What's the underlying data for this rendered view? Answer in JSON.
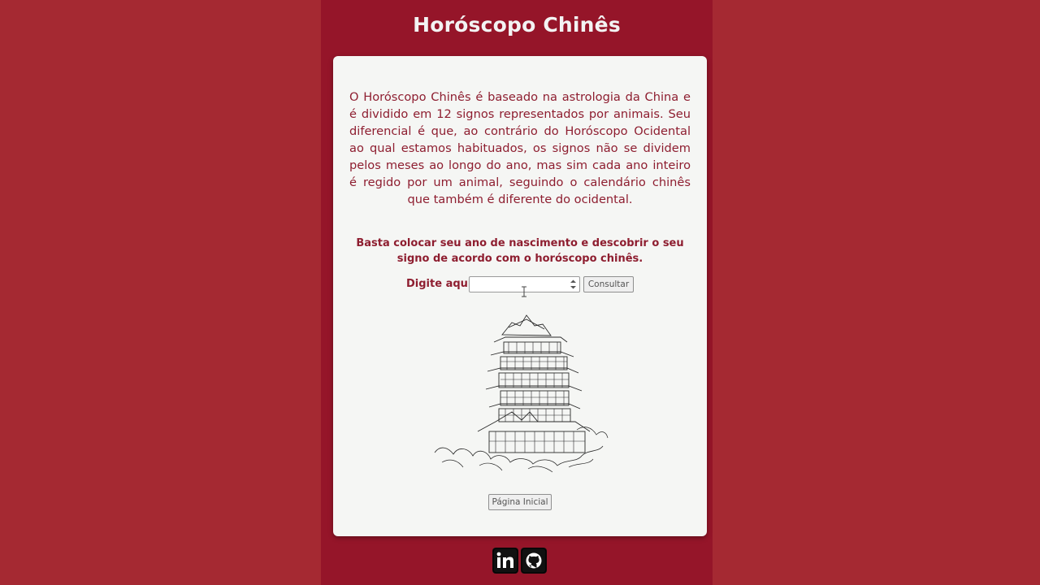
{
  "page": {
    "title": "Horóscopo Chinês",
    "colors": {
      "outer_bg": "#a52932",
      "page_bg": "#951529",
      "card_bg": "#f5f6f4",
      "text": "#8e1e30"
    }
  },
  "card": {
    "intro": "O Horóscopo Chinês é baseado na astrologia da China e é dividido em 12 signos representados por animais. Seu diferencial é que, ao contrário do Horóscopo Ocidental ao qual estamos habituados, os signos não se dividem pelos meses ao longo do ano, mas sim cada ano inteiro é regido por um animal, seguindo o calendário chinês que também é diferente do ocidental.",
    "call_to_action": "Basta colocar seu ano de nascimento e descobrir o seu signo de acordo com o horóscopo chinês.",
    "form": {
      "label": "Digite aqui:",
      "input_value": "",
      "submit_label": "Consultar"
    },
    "illustration": "pagoda-illustration",
    "home_button_label": "Página Inicial"
  },
  "footer": {
    "icons": [
      "linkedin-icon",
      "github-icon"
    ]
  }
}
